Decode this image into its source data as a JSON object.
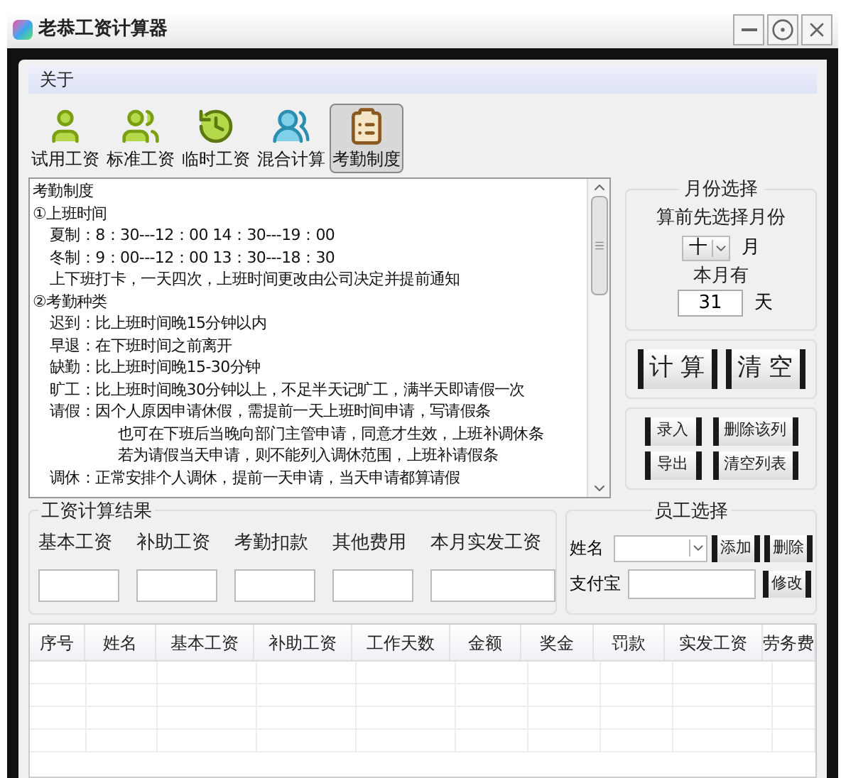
{
  "window": {
    "title": "老恭工资计算器"
  },
  "menu": [
    {
      "label": "关于"
    }
  ],
  "toolbar": [
    {
      "label": "试用工资",
      "kind": "person",
      "selected": false
    },
    {
      "label": "标准工资",
      "kind": "group",
      "selected": false
    },
    {
      "label": "临时工资",
      "kind": "clock",
      "selected": false
    },
    {
      "label": "混合计算",
      "kind": "pair",
      "selected": false
    },
    {
      "label": "考勤制度",
      "kind": "clipboard",
      "selected": true
    }
  ],
  "rules_text": [
    {
      "kind": "title",
      "text": "考勤制度"
    },
    {
      "kind": "section",
      "text": "①上班时间"
    },
    {
      "kind": "item",
      "text": "夏制：8：30---12：00  14：30---19：00"
    },
    {
      "kind": "item",
      "text": "冬制：9：00---12：00  13：30---18：30"
    },
    {
      "kind": "item",
      "text": "上下班打卡，一天四次，上班时间更改由公司决定并提前通知"
    },
    {
      "kind": "section",
      "text": "②考勤种类"
    },
    {
      "kind": "item",
      "text": "迟到：比上班时间晚15分钟以内"
    },
    {
      "kind": "item",
      "text": "早退：在下班时间之前离开"
    },
    {
      "kind": "item",
      "text": "缺勤：比上班时间晚15-30分钟"
    },
    {
      "kind": "item",
      "text": "旷工：比上班时间晚30分钟以上，不足半天记旷工，满半天即请假一次"
    },
    {
      "kind": "item",
      "text": "请假：因个人原因申请休假，需提前一天上班时间申请，写请假条"
    },
    {
      "kind": "continuation",
      "text": "也可在下班后当晚向部门主管申请，同意才生效，上班补调休条"
    },
    {
      "kind": "continuation",
      "text": "若为请假当天申请，则不能列入调休范围，上班补请假条"
    },
    {
      "kind": "item",
      "text": "调休：正常安排个人调休，提前一天申请，当天申请都算请假"
    }
  ],
  "month_group": {
    "title": "月份选择",
    "hint": "算前先选择月份",
    "month_value": "十",
    "month_unit": "月",
    "days_label": "本月有",
    "days_value": "31",
    "days_unit": "天"
  },
  "calc_buttons": [
    "计 算",
    "清 空"
  ],
  "list_buttons": [
    "录入",
    "删除该列",
    "导出",
    "清空列表"
  ],
  "result_group": {
    "title": "工资计算结果",
    "fields": [
      "基本工资",
      "补助工资",
      "考勤扣款",
      "其他费用",
      "本月实发工资"
    ]
  },
  "employee_group": {
    "title": "员工选择",
    "name_label": "姓名",
    "add_button": "添加",
    "delete_button": "删除",
    "alipay_label": "支付宝",
    "edit_button": "修改"
  },
  "table": {
    "columns": [
      "序号",
      "姓名",
      "基本工资",
      "补助工资",
      "工作天数",
      "金额",
      "奖金",
      "罚款",
      "实发工资",
      "劳务费"
    ]
  }
}
